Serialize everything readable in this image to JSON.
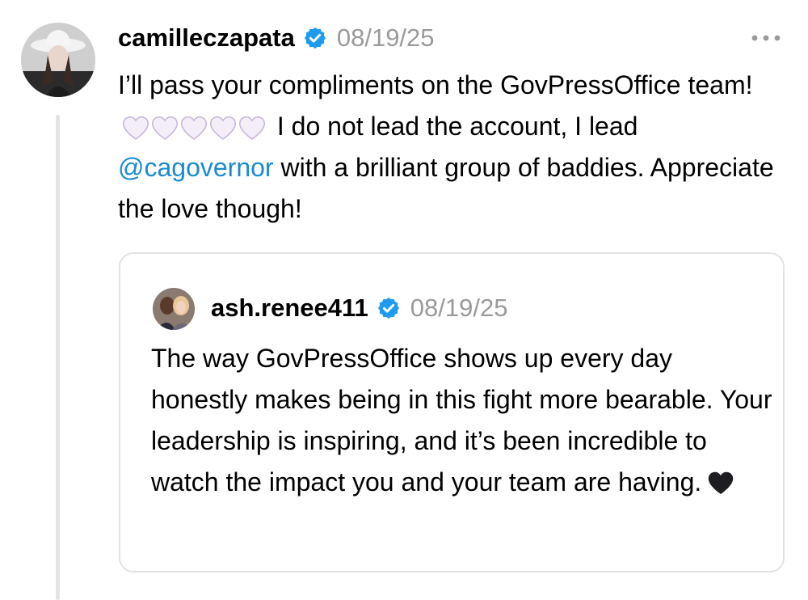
{
  "post": {
    "username": "camilleczapata",
    "timestamp": "08/19/25",
    "body_part1": "I’ll pass your compliments on the GovPressOffice team!",
    "heart_emoji_count": 5,
    "body_part2": "I do not lead the account, I lead",
    "mention": "@cagovernor",
    "body_part3": "with a brilliant group of baddies. Appreciate the love though!",
    "verified_color": "#1d9bf0",
    "mention_color": "#1a8bd0"
  },
  "quote": {
    "username": "ash.renee411",
    "timestamp": "08/19/25",
    "body": "The way GovPressOffice shows up every day honestly makes being in this fight more bearable. Your leadership is inspiring, and it’s been incredible to watch the impact you and your team are having."
  },
  "icons": {
    "verified": "verified-badge-icon",
    "more": "more-options-icon",
    "white_heart": "white-heart-emoji",
    "black_heart": "black-heart-emoji"
  }
}
